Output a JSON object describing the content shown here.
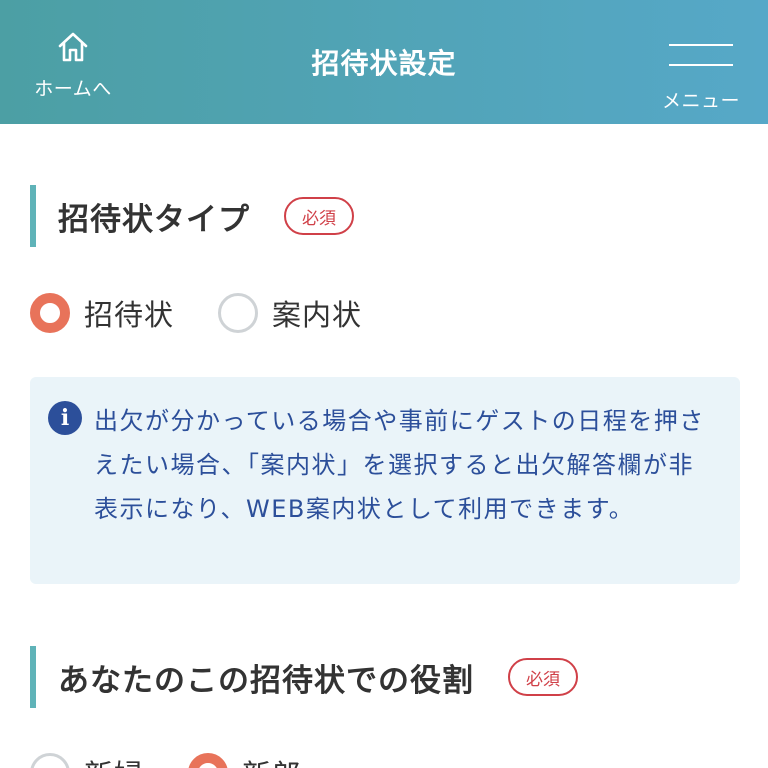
{
  "header": {
    "title": "招待状設定",
    "home_label": "ホームへ",
    "home_icon": "home-icon",
    "menu_label": "メニュー",
    "menu_icon": "hamburger-menu-icon",
    "gradient_start": "#4c9fa4",
    "gradient_end": "#56a8c8"
  },
  "invitation_type": {
    "title": "招待状タイプ",
    "required_badge": "必須",
    "options": [
      {
        "label": "招待状",
        "selected": true
      },
      {
        "label": "案内状",
        "selected": false
      }
    ]
  },
  "info": {
    "icon": "info-icon",
    "text": "出欠が分かっている場合や事前にゲストの日程を押さえたい場合、「案内状」を選択すると出欠解答欄が非表示になり、WEB案内状として利用できます。"
  },
  "role": {
    "title": "あなたのこの招待状での役割",
    "required_badge": "必須",
    "options": [
      {
        "label": "新婦",
        "selected": false
      },
      {
        "label": "新郎",
        "selected": true
      }
    ]
  },
  "colors": {
    "accent_bar": "#5fb3b8",
    "radio_selected": "#e8735a",
    "badge_red": "#d04048",
    "info_text": "#2c4f9a",
    "info_bg": "#eaf4f9"
  }
}
